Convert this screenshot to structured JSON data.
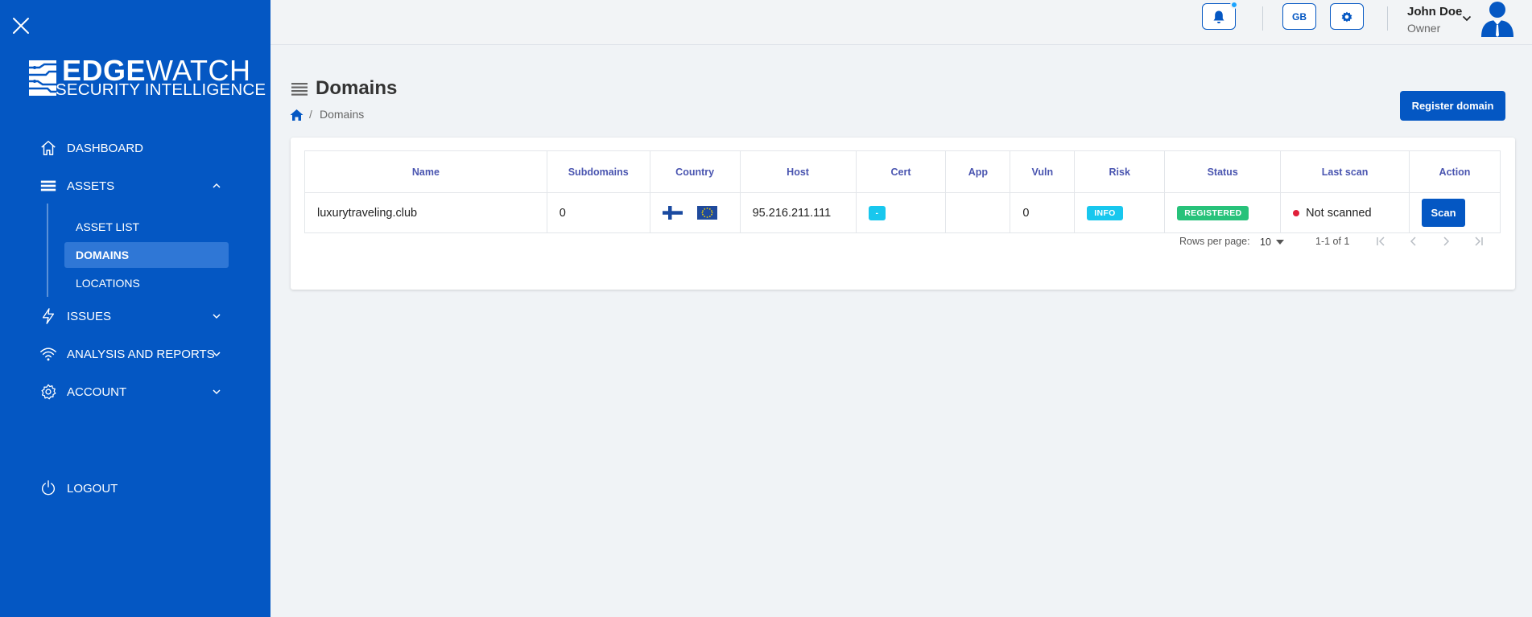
{
  "brand": {
    "name_bold": "EDGE",
    "name_light": "WATCH",
    "tagline": "SECURITY INTELLIGENCE"
  },
  "sidebar": {
    "items": [
      {
        "label": "DASHBOARD",
        "icon": "home-icon"
      },
      {
        "label": "ASSETS",
        "icon": "layers-icon",
        "expanded": true,
        "children": [
          {
            "label": "ASSET LIST"
          },
          {
            "label": "DOMAINS",
            "active": true
          },
          {
            "label": "LOCATIONS"
          }
        ]
      },
      {
        "label": "ISSUES",
        "icon": "bolt-icon"
      },
      {
        "label": "ANALYSIS AND REPORTS",
        "icon": "wifi-icon"
      },
      {
        "label": "ACCOUNT",
        "icon": "gear-icon"
      }
    ],
    "logout": "LOGOUT"
  },
  "topbar": {
    "language": "GB",
    "user": {
      "name": "John Doe",
      "role": "Owner"
    }
  },
  "page": {
    "title": "Domains",
    "breadcrumb": "Domains",
    "primary_action": "Register domain"
  },
  "table": {
    "columns": [
      "Name",
      "Subdomains",
      "Country",
      "Host",
      "Cert",
      "App",
      "Vuln",
      "Risk",
      "Status",
      "Last scan",
      "Action"
    ],
    "rows": [
      {
        "name": "luxurytraveling.club",
        "subdomains": "0",
        "country_flags": [
          "finland-flag",
          "eu-flag"
        ],
        "host": "95.216.211.111",
        "cert": "-",
        "app": "",
        "vuln": "0",
        "risk": "INFO",
        "status": "REGISTERED",
        "last_scan": "Not scanned",
        "action": "Scan"
      }
    ]
  },
  "pagination": {
    "rows_per_page_label": "Rows per page:",
    "rows_per_page": "10",
    "range": "1-1 of 1"
  },
  "colors": {
    "sidebar": "#0457c3",
    "primary": "#0457c3",
    "active_item": "#2f77d6",
    "chip_cyan": "#18c7ee",
    "chip_green": "#27c27a",
    "status_dot": "#e0203a",
    "header_text": "#4a55b0"
  }
}
